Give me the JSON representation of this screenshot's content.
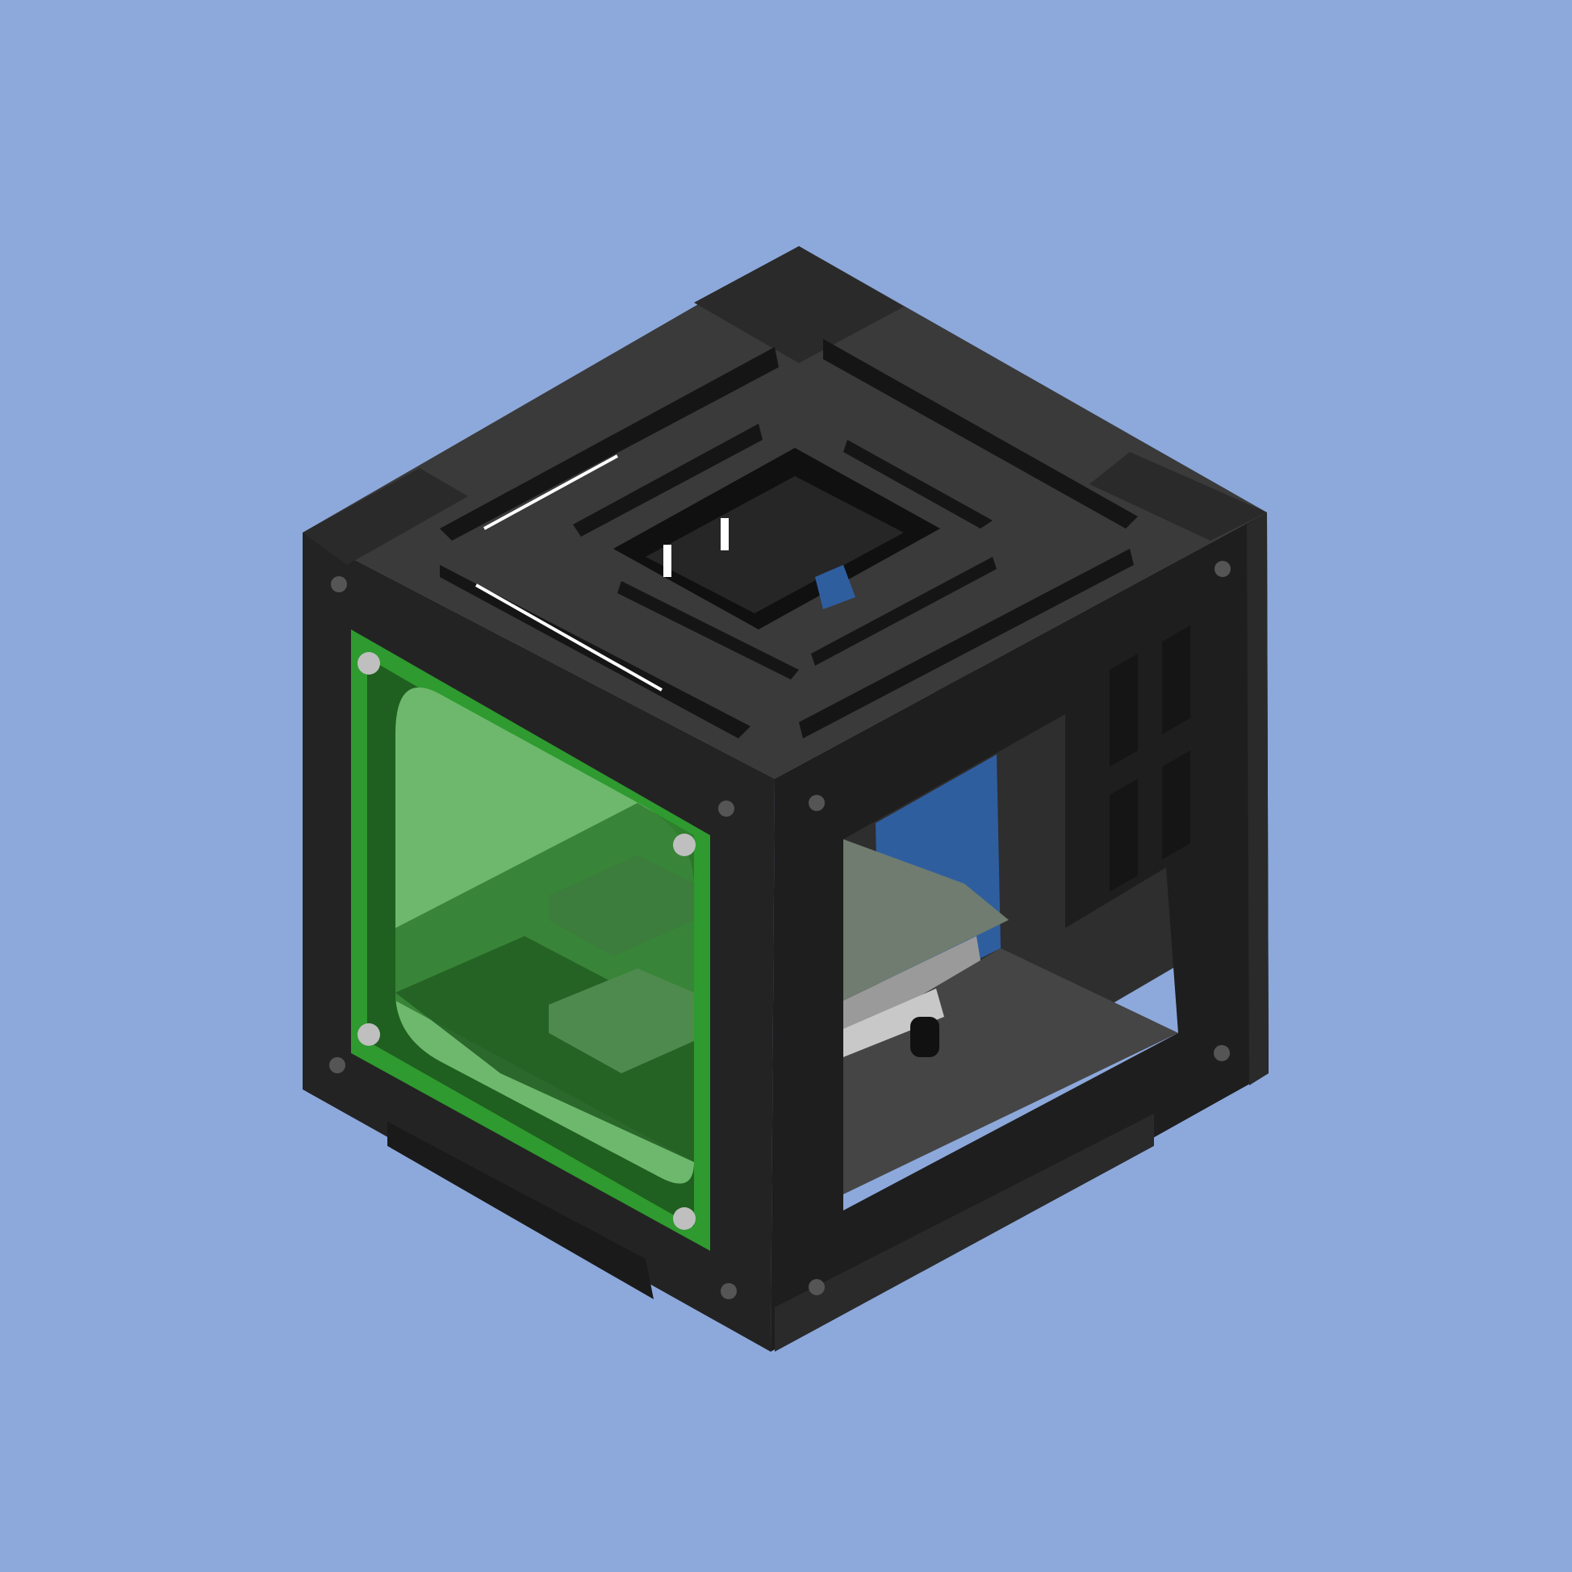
{
  "scene": {
    "subject": "enclosure-3d-model",
    "view": "isometric"
  },
  "colors": {
    "background": "#8DA9DC",
    "frame_front": "#232323",
    "frame_side": "#1E1E1E",
    "frame_top": "#3A3A3A",
    "frame_top_inner": "#2C2C2C",
    "slot_dark": "#151515",
    "interior": "#2E2E2E",
    "floor": "#454545",
    "panel_green": "#2F9A2F",
    "panel_green_light": "#6DB86D",
    "panel_green_dark": "#1F5F1F",
    "bracket_blue": "#2F5E9F",
    "board_grey": "#6F7C6F",
    "screw": "#BFBFBF"
  }
}
